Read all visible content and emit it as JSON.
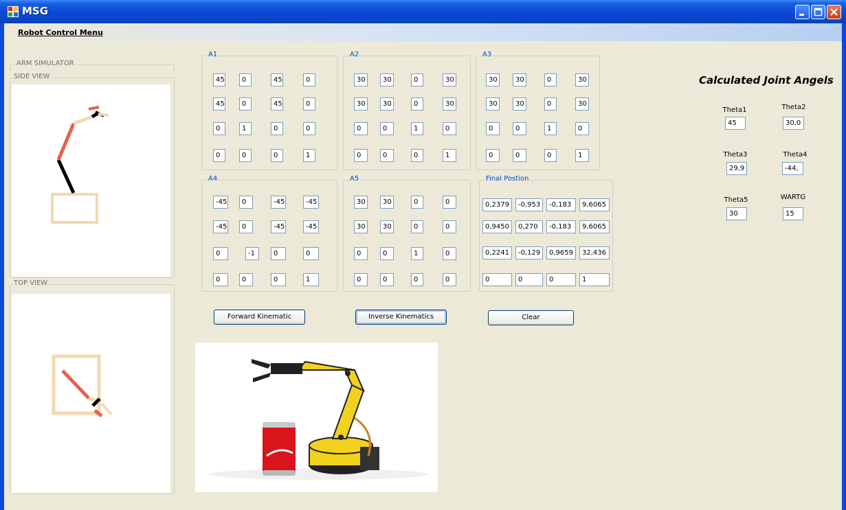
{
  "window": {
    "title": "MSG"
  },
  "menu": {
    "robot_control": "Robot Control Menu"
  },
  "arm_simulator": {
    "label": "ARM SIMULATOR",
    "side_view": "SIDE VIEW",
    "top_view": "TOP VIEW"
  },
  "matrices": [
    {
      "label": "A1",
      "rows": [
        [
          "45",
          "0",
          "45",
          "0"
        ],
        [
          "45",
          "0",
          "45",
          "0"
        ],
        [
          "0",
          "1",
          "0",
          "0"
        ],
        [
          "0",
          "0",
          "0",
          "1"
        ]
      ]
    },
    {
      "label": "A2",
      "rows": [
        [
          "30",
          "30",
          "0",
          "30"
        ],
        [
          "30",
          "30",
          "0",
          "30"
        ],
        [
          "0",
          "0",
          "1",
          "0"
        ],
        [
          "0",
          "0",
          "0",
          "1"
        ]
      ]
    },
    {
      "label": "A3",
      "rows": [
        [
          "30",
          "30",
          "0",
          "30"
        ],
        [
          "30",
          "30",
          "0",
          "30"
        ],
        [
          "0",
          "0",
          "1",
          "0"
        ],
        [
          "0",
          "0",
          "0",
          "1"
        ]
      ]
    },
    {
      "label": "A4",
      "rows": [
        [
          "-45",
          "0",
          "-45",
          "-45"
        ],
        [
          "-45",
          "0",
          "-45",
          "-45"
        ],
        [
          "0",
          "-1",
          "0",
          "0"
        ],
        [
          "0",
          "0",
          "0",
          "1"
        ]
      ]
    },
    {
      "label": "A5",
      "rows": [
        [
          "30",
          "30",
          "0",
          "0"
        ],
        [
          "30",
          "30",
          "0",
          "0"
        ],
        [
          "0",
          "0",
          "1",
          "0"
        ],
        [
          "0",
          "0",
          "0",
          "0"
        ]
      ]
    },
    {
      "label": "Final Postion",
      "rows": [
        [
          "0,2379",
          "-0,953",
          "-0,183",
          "9,6065"
        ],
        [
          "0,9450",
          "0,270",
          "-0,183",
          "9,6065"
        ],
        [
          "0,2241",
          "-0,129",
          "0,9659",
          "32,436"
        ],
        [
          "0",
          "0",
          "0",
          "1"
        ]
      ]
    }
  ],
  "buttons": {
    "forward": "Forward Kinematic",
    "inverse": "Inverse Kinematics",
    "clear": "Clear"
  },
  "joint_angles": {
    "heading": "Calculated Joint Angels",
    "theta1_label": "Theta1",
    "theta1": "45",
    "theta2_label": "Theta2",
    "theta2": "30,0",
    "theta3_label": "Theta3",
    "theta3": "29,9",
    "theta4_label": "Theta4",
    "theta4": "-44,",
    "theta5_label": "Theta5",
    "theta5": "30",
    "wartg_label": "WARTG",
    "wartg": "15"
  },
  "colors": {
    "title_bar": "#0a4ad8",
    "link_red": "#e8604c",
    "link_tan": "#f3d9b1",
    "link_black": "#000000"
  }
}
